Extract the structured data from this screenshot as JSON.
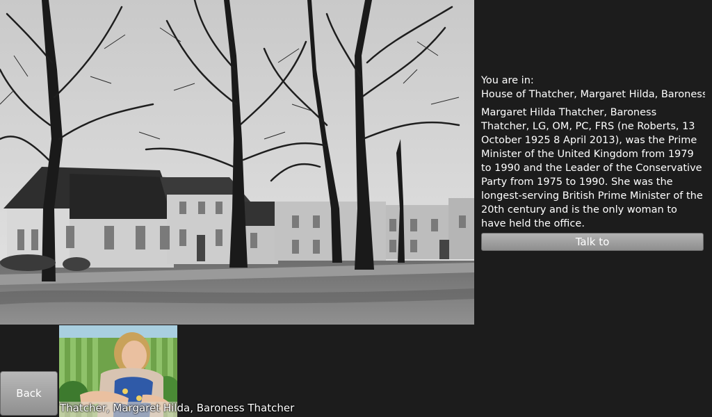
{
  "location": {
    "label": "You are in:",
    "name": "House of Thatcher, Margaret Hilda, Baroness",
    "description": "Margaret Hilda Thatcher, Baroness Thatcher, LG, OM, PC, FRS (ne Roberts, 13 October 1925  8 April 2013), was the Prime Minister of the United Kingdom from 1979 to 1990 and the Leader of the Conservative Party from 1975 to 1990.  She was the longest-serving British Prime Minister of the 20th century and is the only woman to have held the office."
  },
  "actions": {
    "talk_label": "Talk to",
    "back_label": "Back"
  },
  "character": {
    "caption": "Thatcher, Margaret Hilda, Baroness Thatcher"
  },
  "colors": {
    "background": "#1c1c1c",
    "button_top": "#b3b3b3",
    "button_bottom": "#8e8e8e",
    "text": "#ffffff"
  }
}
